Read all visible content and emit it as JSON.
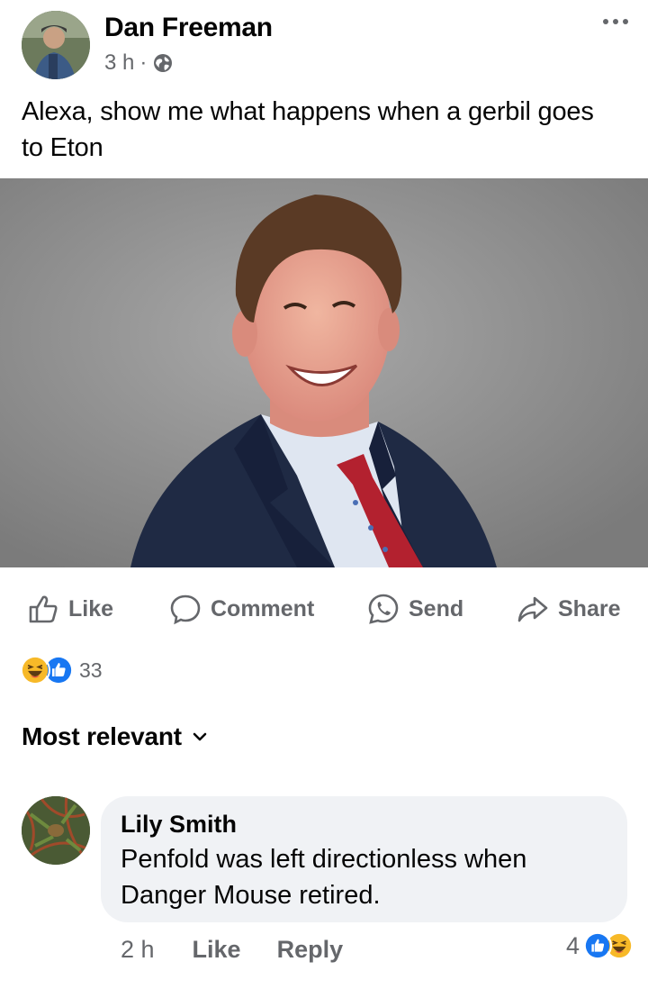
{
  "post": {
    "author": "Dan Freeman",
    "time": "3 h",
    "separator": "·",
    "privacy_icon": "globe-icon",
    "more_icon": "ellipsis-icon",
    "text": "Alexa, show me what happens when a gerbil goes to Eton"
  },
  "actions": {
    "like": "Like",
    "comment": "Comment",
    "send": "Send",
    "share": "Share"
  },
  "reactions": {
    "count": "33",
    "icons": [
      "haha-icon",
      "like-icon"
    ]
  },
  "sort": {
    "label": "Most relevant",
    "icon": "chevron-down-icon"
  },
  "comments": [
    {
      "author": "Lily Smith",
      "text": "Penfold was left directionless when Danger Mouse retired.",
      "time": "2 h",
      "like_label": "Like",
      "reply_label": "Reply",
      "reaction_count": "4",
      "reaction_icons": [
        "like-icon",
        "haha-icon"
      ]
    }
  ],
  "colors": {
    "accent_blue": "#1877f2",
    "secondary_text": "#65676b",
    "bubble_bg": "#f0f2f5",
    "haha_yellow": "#f7b928"
  }
}
